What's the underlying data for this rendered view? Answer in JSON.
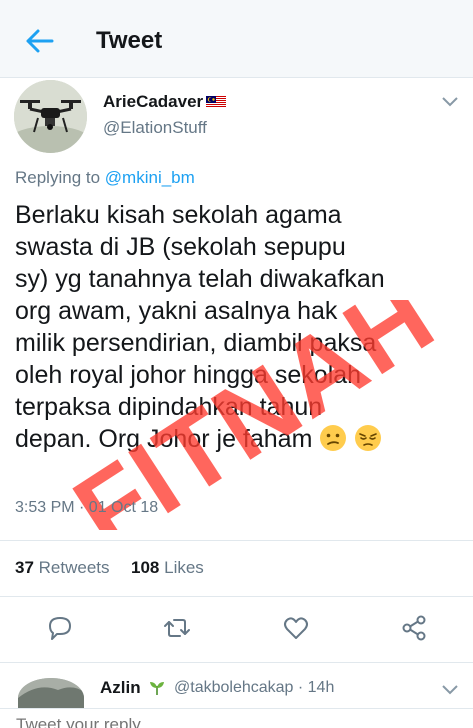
{
  "header": {
    "title": "Tweet",
    "back_icon": "arrow-left-icon",
    "accent_color": "#1da1f2"
  },
  "tweet": {
    "author_name": "ArieCadaver",
    "author_flag": "malaysia-flag-icon",
    "author_handle": "@ElationStuff",
    "reply_prefix": "Replying to",
    "reply_mention": "@mkini_bm",
    "text_lines": [
      "Berlaku kisah sekolah agama",
      "swasta di JB (sekolah sepupu",
      "sy) yg tanahnya telah diwakafkan",
      "org awam, yakni asalnya hak",
      "milik persendirian, diambil paksa",
      "oleh royal johor hingga sekolah",
      "terpaksa dipindahkan tahun",
      "depan. Org Johor je faham"
    ],
    "emojis": [
      "confused-face-icon",
      "relieved-face-icon"
    ],
    "timestamp": "3:53 PM · 01 Oct 18",
    "retweets_count": "37",
    "retweets_label": "Retweets",
    "likes_count": "108",
    "likes_label": "Likes",
    "stamp_text": "FITNAH",
    "stamp_color": "#ff3b30"
  },
  "actions": [
    "reply-icon",
    "retweet-icon",
    "like-icon",
    "share-icon"
  ],
  "reply": {
    "name": "Azlin",
    "handle_time": "@takbolehcakap · 14h"
  },
  "compose": {
    "placeholder": "Tweet your reply"
  }
}
